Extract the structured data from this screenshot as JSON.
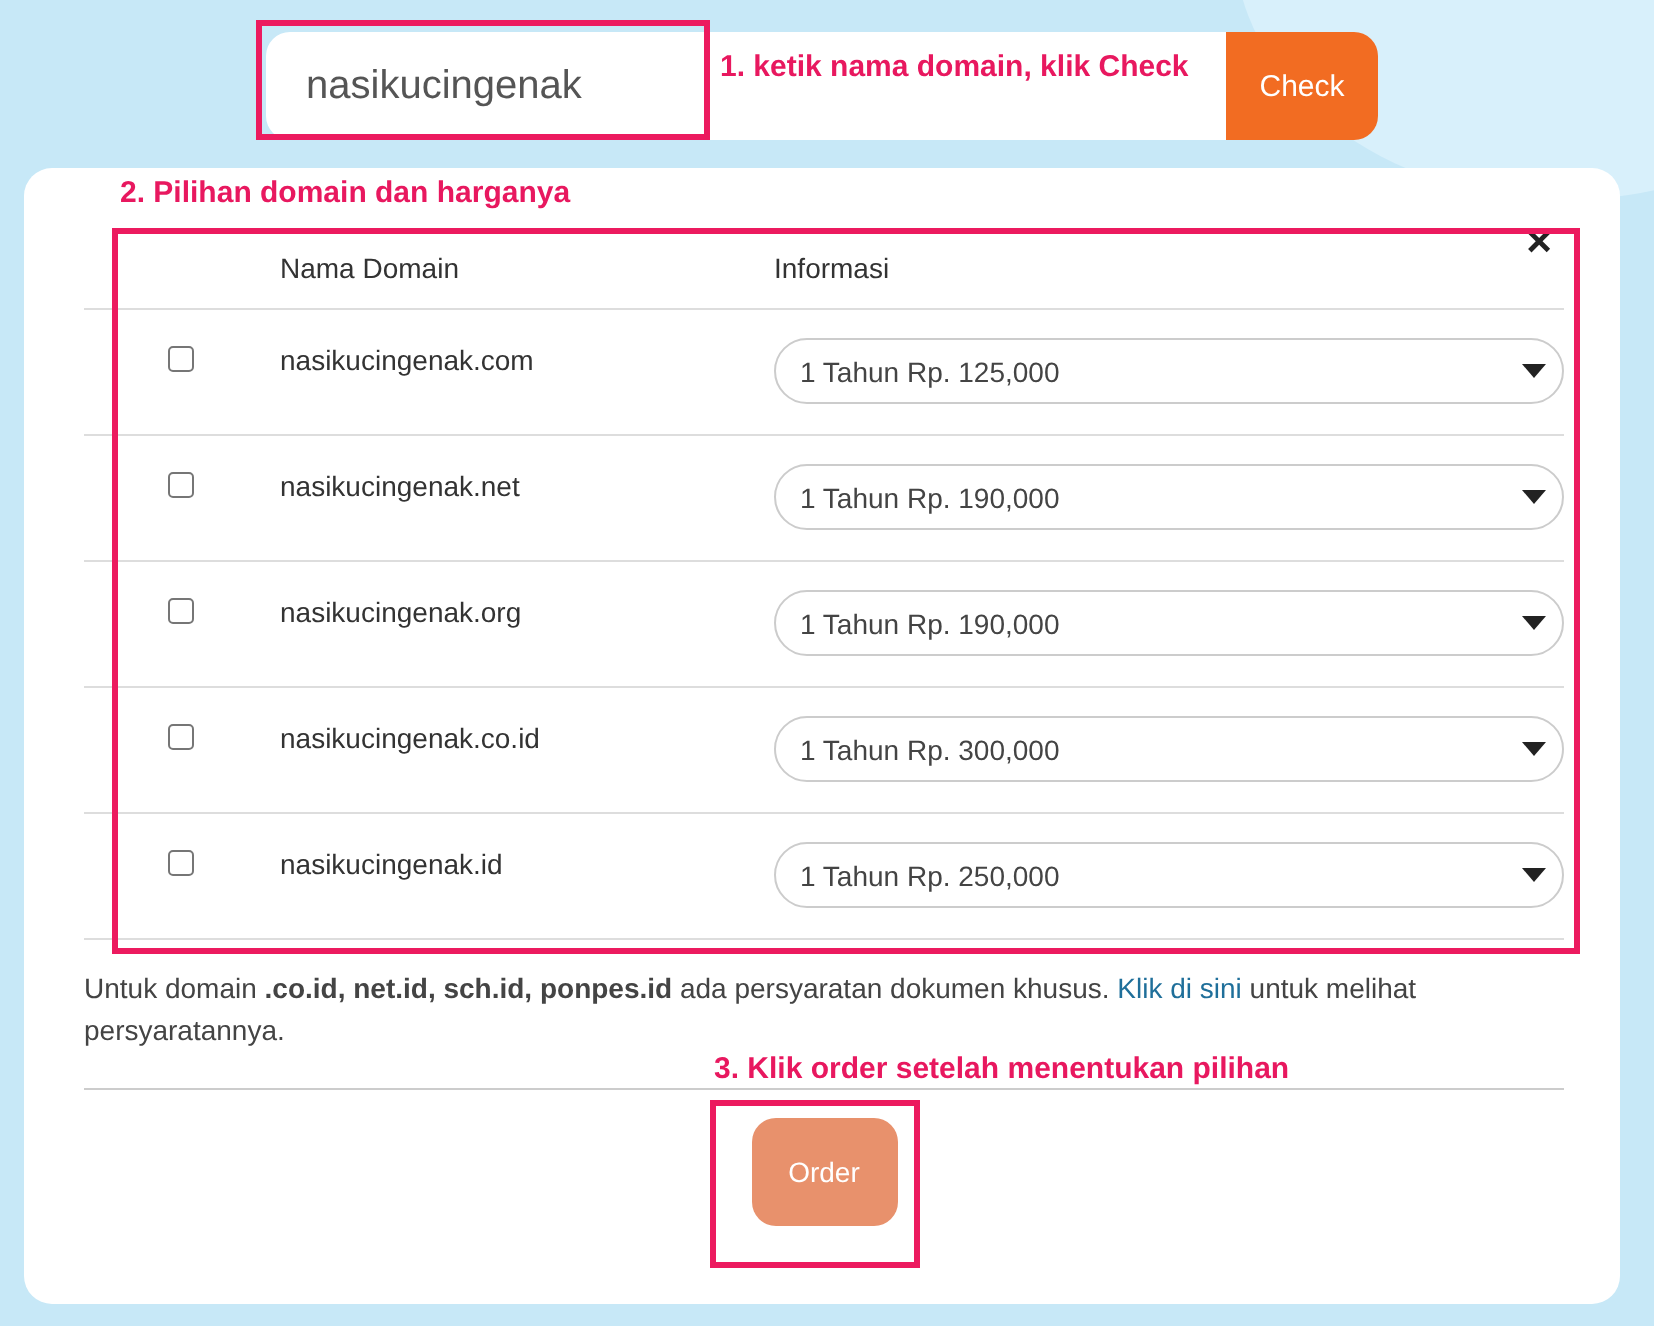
{
  "search": {
    "value": "nasikucingenak",
    "button": "Check"
  },
  "table": {
    "columns": [
      "Nama Domain",
      "Informasi"
    ],
    "close": "×",
    "rows": [
      {
        "checked": false,
        "domain": "nasikucingenak.com",
        "price": "1 Tahun Rp. 125,000"
      },
      {
        "checked": false,
        "domain": "nasikucingenak.net",
        "price": "1 Tahun Rp. 190,000"
      },
      {
        "checked": false,
        "domain": "nasikucingenak.org",
        "price": "1 Tahun Rp. 190,000"
      },
      {
        "checked": false,
        "domain": "nasikucingenak.co.id",
        "price": "1 Tahun Rp. 300,000"
      },
      {
        "checked": false,
        "domain": "nasikucingenak.id",
        "price": "1 Tahun Rp. 250,000"
      }
    ]
  },
  "note": {
    "before": "Untuk domain **.co.id, net.id, sch.id, ponpes.id** ada persyaratan dokumen khusus. ",
    "link": "Klik di sini",
    "after": " untuk melihat persyaratannya."
  },
  "order_button": {
    "label": "Order",
    "disabled": true
  },
  "annotations": [
    "1. ketik nama domain, klik Check",
    "2. Pilihan domain dan harganya",
    "3. Klik order setelah menentukan pilihan"
  ]
}
